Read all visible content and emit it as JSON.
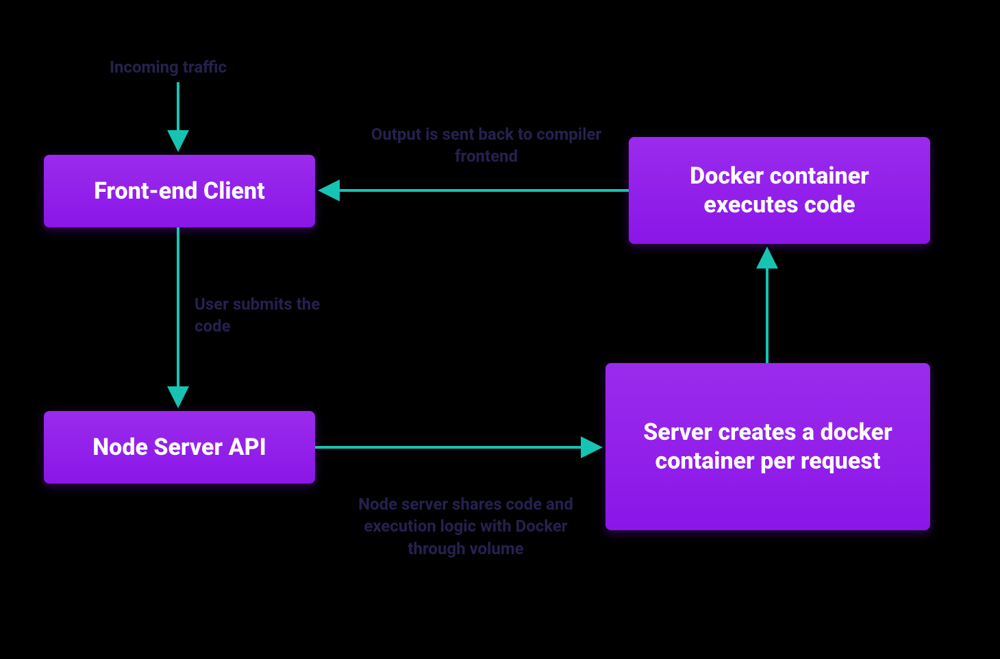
{
  "colors": {
    "background": "#000000",
    "node_fill_top": "#9b2bec",
    "node_fill_bottom": "#8a16e8",
    "node_text": "#ffffff",
    "arrow": "#17c3b2",
    "label": "#25214f"
  },
  "nodes": {
    "frontend": {
      "text": "Front-end Client"
    },
    "nodeapi": {
      "text": "Node Server API"
    },
    "server_creates": {
      "text": "Server creates a docker container per request"
    },
    "docker_exec": {
      "text": "Docker container executes code"
    }
  },
  "edges": {
    "incoming": {
      "from": "external",
      "to": "frontend",
      "label": "Incoming traffic"
    },
    "submit": {
      "from": "frontend",
      "to": "nodeapi",
      "label": "User submits the code"
    },
    "share": {
      "from": "nodeapi",
      "to": "server_creates",
      "label": "Node server shares code and execution logic with Docker through volume"
    },
    "exec": {
      "from": "server_creates",
      "to": "docker_exec",
      "label": ""
    },
    "output": {
      "from": "docker_exec",
      "to": "frontend",
      "label": "Output is sent back to compiler frontend"
    }
  }
}
